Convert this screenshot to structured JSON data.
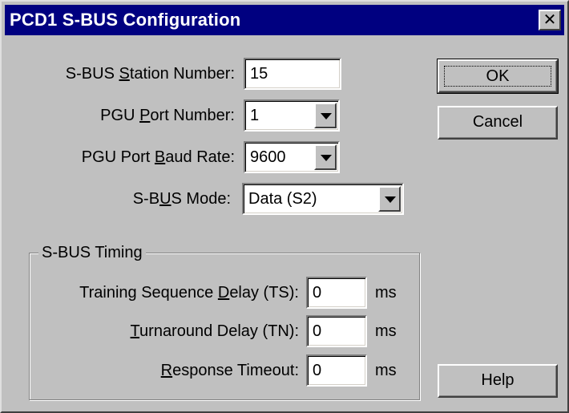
{
  "window": {
    "title": "PCD1 S-BUS Configuration",
    "close_label": "✕"
  },
  "fields": {
    "station_number": {
      "label_pre": "S-BUS ",
      "label_key": "S",
      "label_post": "tation Number:",
      "value": "15"
    },
    "pgu_port_number": {
      "label_pre": "PGU ",
      "label_key": "P",
      "label_post": "ort Number:",
      "value": "1"
    },
    "pgu_port_baud_rate": {
      "label_pre": "PGU Port ",
      "label_key": "B",
      "label_post": "aud Rate:",
      "value": "9600"
    },
    "sbus_mode": {
      "label_pre": "S-B",
      "label_key": "U",
      "label_post": "S Mode:",
      "value": "Data (S2)"
    }
  },
  "timing": {
    "group_title": "S-BUS Timing",
    "training_delay": {
      "label_pre": "Training Sequence ",
      "label_key": "D",
      "label_post": "elay (TS):",
      "value": "0",
      "unit": "ms"
    },
    "turnaround_delay": {
      "label_pre": "",
      "label_key": "T",
      "label_post": "urnaround Delay (TN):",
      "value": "0",
      "unit": "ms"
    },
    "response_timeout": {
      "label_pre": "",
      "label_key": "R",
      "label_post": "esponse Timeout:",
      "value": "0",
      "unit": "ms"
    }
  },
  "buttons": {
    "ok": "OK",
    "cancel": "Cancel",
    "help": "Help"
  },
  "colors": {
    "titlebar": "#000080",
    "face": "#c0c0c0"
  }
}
